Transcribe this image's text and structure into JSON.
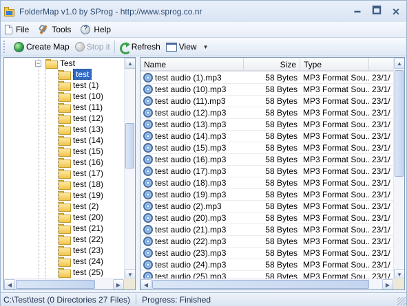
{
  "window": {
    "title": "FolderMap v1.0 by SProg - http://www.sprog.co.nr",
    "minimize": "🗕",
    "maximize": "🗖",
    "close": "✕"
  },
  "menu": [
    {
      "label": "File",
      "icon": "file-icon"
    },
    {
      "label": "Tools",
      "icon": "tools-icon"
    },
    {
      "label": "Help",
      "icon": "help-icon"
    }
  ],
  "toolbar": {
    "create_map": "Create Map",
    "stop_it": "Stop it",
    "refresh": "Refresh",
    "view": "View"
  },
  "tree": {
    "root": "Test",
    "children": [
      "test",
      "test (1)",
      "test (10)",
      "test (11)",
      "test (12)",
      "test (13)",
      "test (14)",
      "test (15)",
      "test (16)",
      "test (17)",
      "test (18)",
      "test (19)",
      "test (2)",
      "test (20)",
      "test (21)",
      "test (22)",
      "test (23)",
      "test (24)",
      "test (25)"
    ],
    "selected": "test"
  },
  "list": {
    "columns": [
      "Name",
      "Size",
      "Type",
      ""
    ],
    "rows": [
      {
        "name": "test audio (1).mp3",
        "size": "58 Bytes",
        "type": "MP3 Format Sou...",
        "date": "23/1/"
      },
      {
        "name": "test audio (10).mp3",
        "size": "58 Bytes",
        "type": "MP3 Format Sou...",
        "date": "23/1/"
      },
      {
        "name": "test audio (11).mp3",
        "size": "58 Bytes",
        "type": "MP3 Format Sou...",
        "date": "23/1/"
      },
      {
        "name": "test audio (12).mp3",
        "size": "58 Bytes",
        "type": "MP3 Format Sou...",
        "date": "23/1/"
      },
      {
        "name": "test audio (13).mp3",
        "size": "58 Bytes",
        "type": "MP3 Format Sou...",
        "date": "23/1/"
      },
      {
        "name": "test audio (14).mp3",
        "size": "58 Bytes",
        "type": "MP3 Format Sou...",
        "date": "23/1/"
      },
      {
        "name": "test audio (15).mp3",
        "size": "58 Bytes",
        "type": "MP3 Format Sou...",
        "date": "23/1/"
      },
      {
        "name": "test audio (16).mp3",
        "size": "58 Bytes",
        "type": "MP3 Format Sou...",
        "date": "23/1/"
      },
      {
        "name": "test audio (17).mp3",
        "size": "58 Bytes",
        "type": "MP3 Format Sou...",
        "date": "23/1/"
      },
      {
        "name": "test audio (18).mp3",
        "size": "58 Bytes",
        "type": "MP3 Format Sou...",
        "date": "23/1/"
      },
      {
        "name": "test audio (19).mp3",
        "size": "58 Bytes",
        "type": "MP3 Format Sou...",
        "date": "23/1/"
      },
      {
        "name": "test audio (2).mp3",
        "size": "58 Bytes",
        "type": "MP3 Format Sou...",
        "date": "23/1/"
      },
      {
        "name": "test audio (20).mp3",
        "size": "58 Bytes",
        "type": "MP3 Format Sou...",
        "date": "23/1/"
      },
      {
        "name": "test audio (21).mp3",
        "size": "58 Bytes",
        "type": "MP3 Format Sou...",
        "date": "23/1/"
      },
      {
        "name": "test audio (22).mp3",
        "size": "58 Bytes",
        "type": "MP3 Format Sou...",
        "date": "23/1/"
      },
      {
        "name": "test audio (23).mp3",
        "size": "58 Bytes",
        "type": "MP3 Format Sou...",
        "date": "23/1/"
      },
      {
        "name": "test audio (24).mp3",
        "size": "58 Bytes",
        "type": "MP3 Format Sou...",
        "date": "23/1/"
      },
      {
        "name": "test audio (25).mp3",
        "size": "58 Bytes",
        "type": "MP3 Format Sou...",
        "date": "23/1/"
      }
    ]
  },
  "status": {
    "path": "C:\\Test\\test (0 Directories 27 Files)",
    "progress": "Progress: Finished"
  },
  "colors": {
    "selection": "#316ac5",
    "title_text": "#2c4a74",
    "folder": "#f1c44a"
  }
}
